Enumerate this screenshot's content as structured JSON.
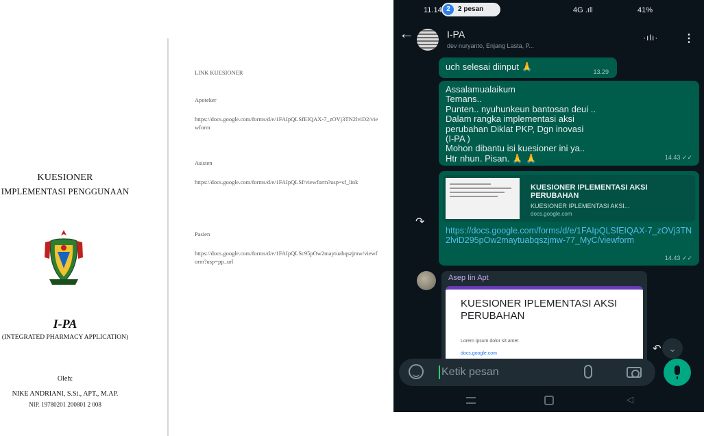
{
  "document": {
    "title_line1": "KUESIONER",
    "title_line2": "IMPLEMENTASI PENGGUNAAN",
    "brand": "I-PA",
    "brand_sub": "(INTEGRATED PHARMACY APPLICATION)",
    "by_label": "Oleh:",
    "author": "NIKE ANDRIANI, S.Si., APT., M.AP.",
    "author_id": "NIP. 19780201 200801 2 008"
  },
  "links_doc": {
    "heading": "LINK KUESIONER",
    "blocks": [
      {
        "label": "Apoteker",
        "url": "https://docs.google.com/forms/d/e/1FAIpQLSfEIQAX-7_zOVj3TN2lviD2/viewform"
      },
      {
        "label": "Asisten",
        "url": "https://docs.google.com/forms/d/e/1FAIpQLSf/viewform?usp=sf_link"
      },
      {
        "label": "Pasien",
        "url": "https://docs.google.com/forms/d/e/1FAIpQLSc95pOw2maytuabqszjmw/viewform?usp=pp_url"
      }
    ]
  },
  "status": {
    "time": "11.14",
    "pill_text": "2 pesan",
    "pill_badge": "2",
    "signal": "4G .ıll",
    "battery": "41%"
  },
  "chat_header": {
    "group_name": "I-PA",
    "members": "dev nuryanto, Enjang Lasta, P...",
    "back_glyph": "←",
    "voice_glyph": "·ılı·",
    "menu_glyph": "⋮"
  },
  "messages": {
    "m1": {
      "text": "uch selesai diinput 🙏",
      "time": "13.29"
    },
    "m2": {
      "lines": [
        "Assalamualaikum",
        "Temans..",
        "Punten.. nyuhunkeun bantosan deui ..",
        "Dalam rangka implementasi aksi",
        "perubahan Diklat PKP, Dgn inovasi",
        "(I-PA )",
        "Mohon dibantu isi kuesioner ini ya..",
        "Htr nhun. Pisan. 🙏 🙏"
      ],
      "time": "14.43 ✓✓"
    },
    "m3": {
      "preview_title": "KUESIONER IPLEMENTASI AKSI PERUBAHAN",
      "preview_desc": "KUESIONER IPLEMENTASI AKSI...",
      "preview_domain": "docs.google.com",
      "url": "https://docs.google.com/forms/d/e/1FAIpQLSfEIQAX-7_zOVj3TN2lviD295pOw2maytuabqszjmw-77_MyC/viewform",
      "time": "14.43 ✓✓"
    },
    "m4": {
      "sender": "Asep Iin Apt",
      "form_title": "KUESIONER IPLEMENTASI AKSI PERUBAHAN",
      "form_sub": "Lorem ipsum dolor sit amet",
      "form_link": "docs.google.com"
    },
    "forward_glyph": "↷",
    "reply_glyph": "↶",
    "scroll_glyph": "⌄"
  },
  "composer": {
    "placeholder": "Ketik pesan"
  },
  "colors": {
    "chat_bg": "#0b141a",
    "outgoing_bubble": "#005c4b",
    "incoming_bubble": "#1f2c34",
    "link": "#53bdeb",
    "accent_green": "#00a884",
    "form_accent": "#673ab7"
  },
  "icons": [
    "back-arrow-icon",
    "voice-call-icon",
    "menu-dots-icon",
    "forward-icon",
    "reply-icon",
    "scroll-down-icon",
    "emoji-icon",
    "attach-icon",
    "camera-icon",
    "mic-icon",
    "nav-recent-icon",
    "nav-home-icon",
    "nav-back-icon",
    "emblem-icon"
  ]
}
